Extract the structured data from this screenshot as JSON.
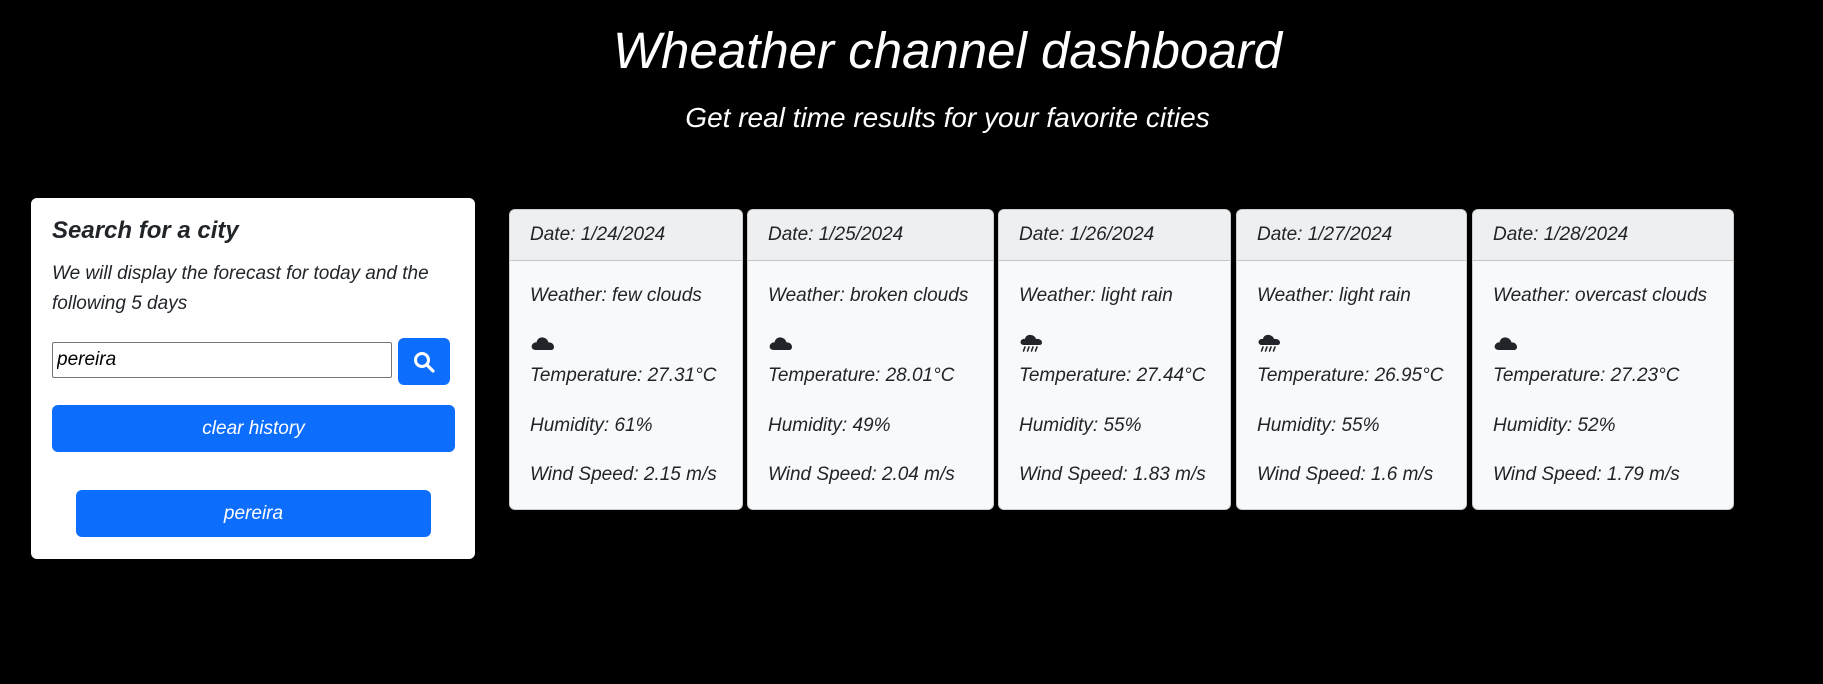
{
  "header": {
    "title": "Wheather channel dashboard",
    "subtitle": "Get real time results for your favorite cities"
  },
  "search": {
    "title": "Search for a city",
    "description": "We will display the forecast for today and the following 5 days",
    "input_value": "pereira",
    "search_icon": "search-icon",
    "clear_label": "clear history",
    "history": [
      "pereira"
    ]
  },
  "colors": {
    "accent": "#0d6efd",
    "background": "#000000",
    "card": "#f8f9fa"
  },
  "forecast": [
    {
      "date": "Date: 1/24/2024",
      "weather": "Weather: few clouds",
      "icon": "cloud-icon",
      "temp": "Temperature: 27.31°C",
      "humidity": "Humidity: 61%",
      "wind": "Wind Speed: 2.15 m/s"
    },
    {
      "date": "Date: 1/25/2024",
      "weather": "Weather: broken clouds",
      "icon": "cloud-icon",
      "temp": "Temperature: 28.01°C",
      "humidity": "Humidity: 49%",
      "wind": "Wind Speed: 2.04 m/s"
    },
    {
      "date": "Date: 1/26/2024",
      "weather": "Weather: light rain",
      "icon": "rain-cloud-icon",
      "temp": "Temperature: 27.44°C",
      "humidity": "Humidity: 55%",
      "wind": "Wind Speed: 1.83 m/s"
    },
    {
      "date": "Date: 1/27/2024",
      "weather": "Weather: light rain",
      "icon": "rain-cloud-icon",
      "temp": "Temperature: 26.95°C",
      "humidity": "Humidity: 55%",
      "wind": "Wind Speed: 1.6 m/s"
    },
    {
      "date": "Date: 1/28/2024",
      "weather": "Weather: overcast clouds",
      "icon": "cloud-icon",
      "temp": "Temperature: 27.23°C",
      "humidity": "Humidity: 52%",
      "wind": "Wind Speed: 1.79 m/s"
    }
  ]
}
